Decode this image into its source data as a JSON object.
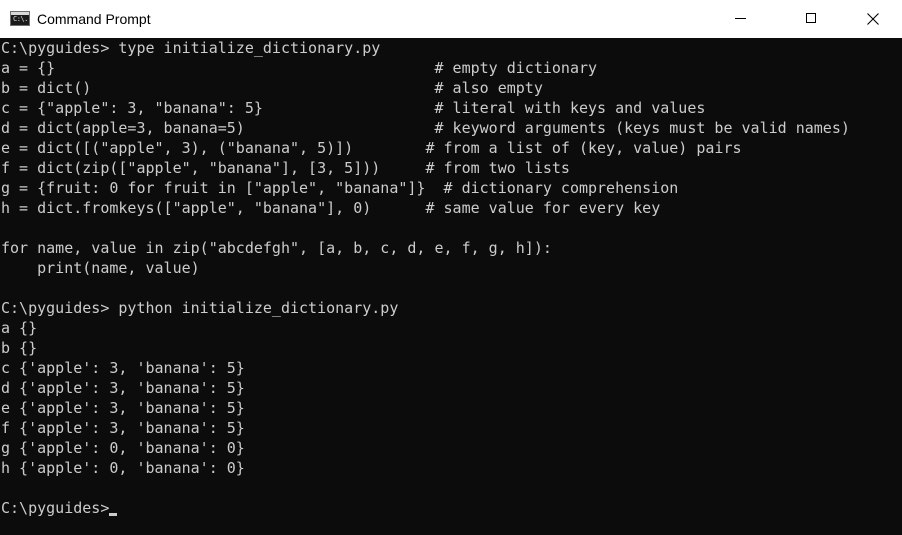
{
  "window": {
    "title": "Command Prompt",
    "icon": "console-icon",
    "icon_glyph": "C:\\.",
    "controls": {
      "minimize_icon": "minimize-icon",
      "maximize_icon": "maximize-icon",
      "close_icon": "close-icon"
    }
  },
  "terminal": {
    "background": "#0c0c0c",
    "foreground": "#cccccc",
    "lines": [
      "C:\\pyguides> type initialize_dictionary.py",
      "a = {}                                          # empty dictionary",
      "b = dict()                                      # also empty",
      "c = {\"apple\": 3, \"banana\": 5}                   # literal with keys and values",
      "d = dict(apple=3, banana=5)                     # keyword arguments (keys must be valid names)",
      "e = dict([(\"apple\", 3), (\"banana\", 5)])        # from a list of (key, value) pairs",
      "f = dict(zip([\"apple\", \"banana\"], [3, 5]))     # from two lists",
      "g = {fruit: 0 for fruit in [\"apple\", \"banana\"]}  # dictionary comprehension",
      "h = dict.fromkeys([\"apple\", \"banana\"], 0)      # same value for every key",
      "",
      "for name, value in zip(\"abcdefgh\", [a, b, c, d, e, f, g, h]):",
      "    print(name, value)",
      "",
      "C:\\pyguides> python initialize_dictionary.py",
      "a {}",
      "b {}",
      "c {'apple': 3, 'banana': 5}",
      "d {'apple': 3, 'banana': 5}",
      "e {'apple': 3, 'banana': 5}",
      "f {'apple': 3, 'banana': 5}",
      "g {'apple': 0, 'banana': 0}",
      "h {'apple': 0, 'banana': 0}",
      "",
      "C:\\pyguides>"
    ]
  }
}
